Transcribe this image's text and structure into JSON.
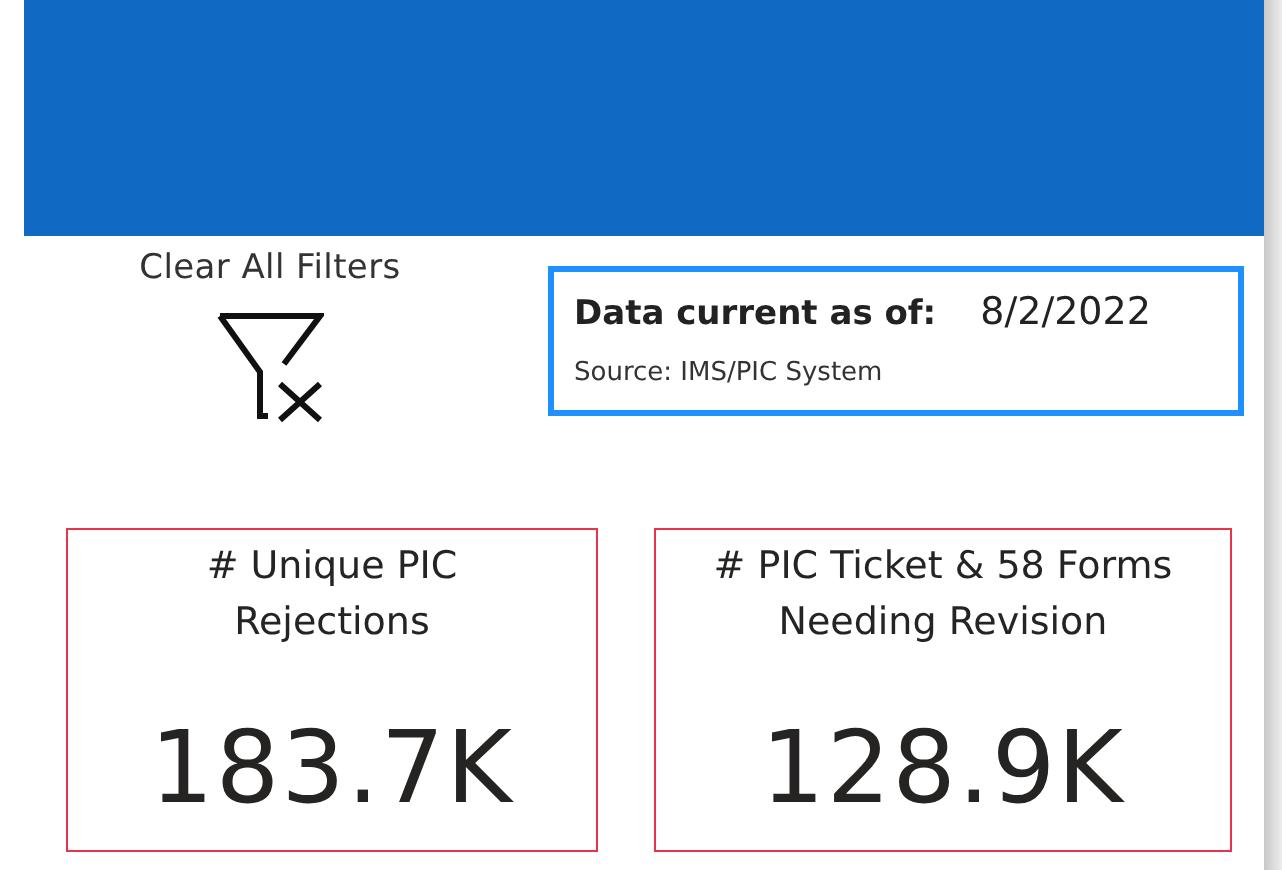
{
  "clear_filters": {
    "label": "Clear All Filters"
  },
  "data_info": {
    "label": "Data current as of:",
    "date": "8/2/2022",
    "source": "Source: IMS/PIC System"
  },
  "kpi_cards": [
    {
      "title": "# Unique PIC Rejections",
      "value": "183.7K"
    },
    {
      "title": "# PIC Ticket & 58 Forms Needing Revision",
      "value": "128.9K"
    }
  ]
}
